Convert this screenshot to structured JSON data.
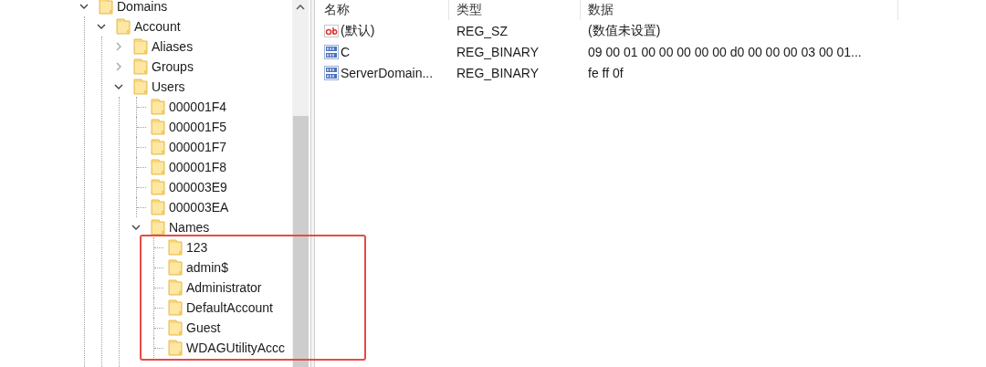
{
  "tree": {
    "nodes": [
      {
        "label": "Domains",
        "expanded": true,
        "children": [
          {
            "label": "Account",
            "expanded": true,
            "children": [
              {
                "label": "Aliases",
                "expanded": false
              },
              {
                "label": "Groups",
                "expanded": false
              },
              {
                "label": "Users",
                "expanded": true,
                "children": [
                  {
                    "label": "000001F4"
                  },
                  {
                    "label": "000001F5"
                  },
                  {
                    "label": "000001F7"
                  },
                  {
                    "label": "000001F8"
                  },
                  {
                    "label": "000003E9"
                  },
                  {
                    "label": "000003EA"
                  },
                  {
                    "label": "Names",
                    "expanded": true,
                    "highlight_children": true,
                    "children": [
                      {
                        "label": "123"
                      },
                      {
                        "label": "admin$"
                      },
                      {
                        "label": "Administrator"
                      },
                      {
                        "label": "DefaultAccount"
                      },
                      {
                        "label": "Guest"
                      },
                      {
                        "label": "WDAGUtilityAccc"
                      }
                    ]
                  }
                ]
              }
            ]
          }
        ]
      }
    ]
  },
  "values": {
    "columns": [
      "名称",
      "类型",
      "数据"
    ],
    "rows": [
      {
        "kind": "string",
        "name": "(默认)",
        "type": "REG_SZ",
        "data": "(数值未设置)"
      },
      {
        "kind": "binary",
        "name": "C",
        "type": "REG_BINARY",
        "data": "09 00 01 00 00 00 00 00 d0 00 00 00 03 00 01..."
      },
      {
        "kind": "binary",
        "name": "ServerDomain...",
        "type": "REG_BINARY",
        "data": "fe ff 0f"
      }
    ]
  }
}
